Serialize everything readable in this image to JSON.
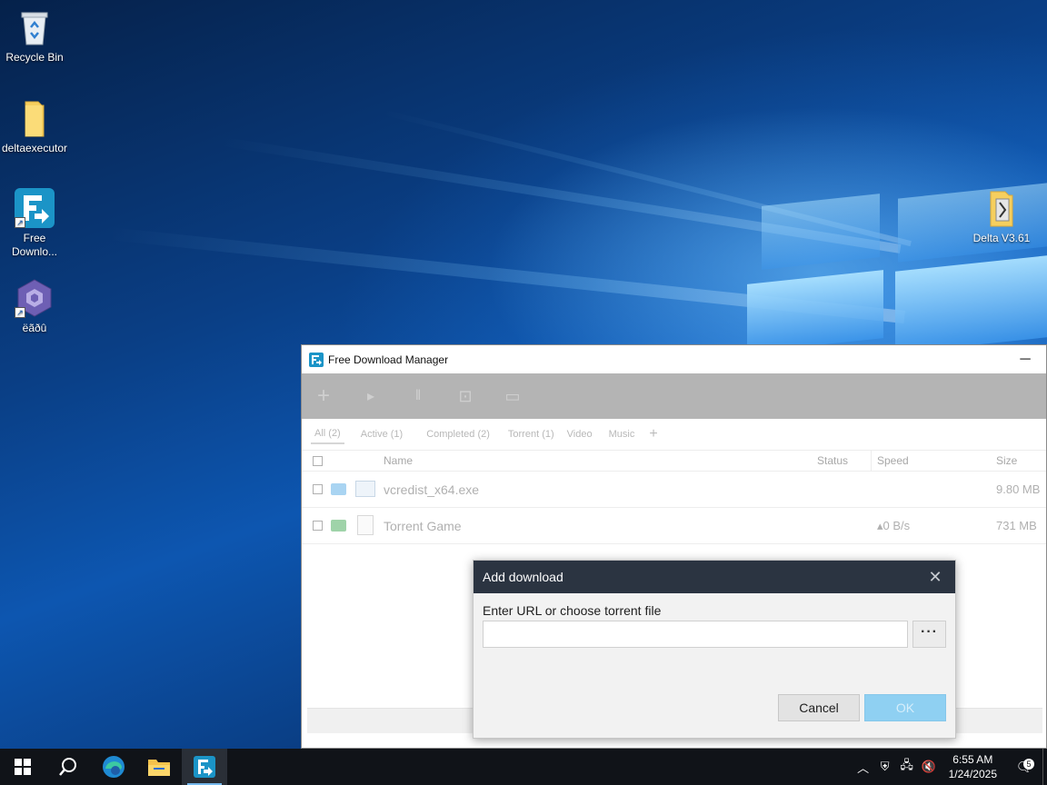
{
  "desktop": {
    "icons": [
      {
        "label": "Recycle Bin",
        "icon": "recycle-bin-icon"
      },
      {
        "label": "deltaexecutor",
        "icon": "folder-icon"
      },
      {
        "label": "Free Downlo...",
        "icon": "free-download-manager-icon"
      },
      {
        "label": "ëãðû",
        "icon": "gamecube-icon"
      },
      {
        "label": "Delta V3.61",
        "icon": "folder-icon"
      }
    ]
  },
  "fdm": {
    "title": "Free Download Manager",
    "minimize_glyph": "─",
    "toolbar": [
      {
        "icon": "add-icon",
        "glyph": "+"
      },
      {
        "icon": "play-icon",
        "glyph": "▸"
      },
      {
        "icon": "pause-icon",
        "glyph": "‖"
      },
      {
        "icon": "delete-icon",
        "glyph": "⊡"
      },
      {
        "icon": "folder-open-icon",
        "glyph": "▭"
      }
    ],
    "tabs": [
      "All (2)",
      "Active (1)",
      "Completed (2)",
      "Torrent (1)",
      "Video",
      "Music"
    ],
    "tab_add": "+",
    "columns": {
      "name": "Name",
      "status": "Status",
      "speed": "Speed",
      "size": "Size"
    },
    "rows": [
      {
        "name": "vcredist_x64.exe",
        "status": "",
        "speed": "",
        "size": "9.80 MB"
      },
      {
        "name": "Torrent Game",
        "status": "",
        "speed": "▴0 B/s",
        "size": "731 MB"
      }
    ]
  },
  "dialog": {
    "title": "Add download",
    "close_glyph": "✕",
    "label": "Enter URL or choose torrent file",
    "url_value": "",
    "browse_label": "···",
    "cancel_label": "Cancel",
    "ok_label": "OK"
  },
  "taskbar": {
    "time": "6:55 AM",
    "date": "1/24/2025",
    "notification_count": "5",
    "tray": [
      {
        "icon": "chevron-up-icon",
        "glyph": "︿"
      },
      {
        "icon": "security-warning-icon",
        "glyph": "⛨"
      },
      {
        "icon": "network-icon",
        "glyph": "🖧"
      },
      {
        "icon": "volume-muted-icon",
        "glyph": "🔇"
      }
    ]
  },
  "colors": {
    "dialog_header": "#2b3441",
    "ok_button": "#8fd0f2",
    "toolbar": "#b4b4b4",
    "taskbar": "#101318"
  }
}
